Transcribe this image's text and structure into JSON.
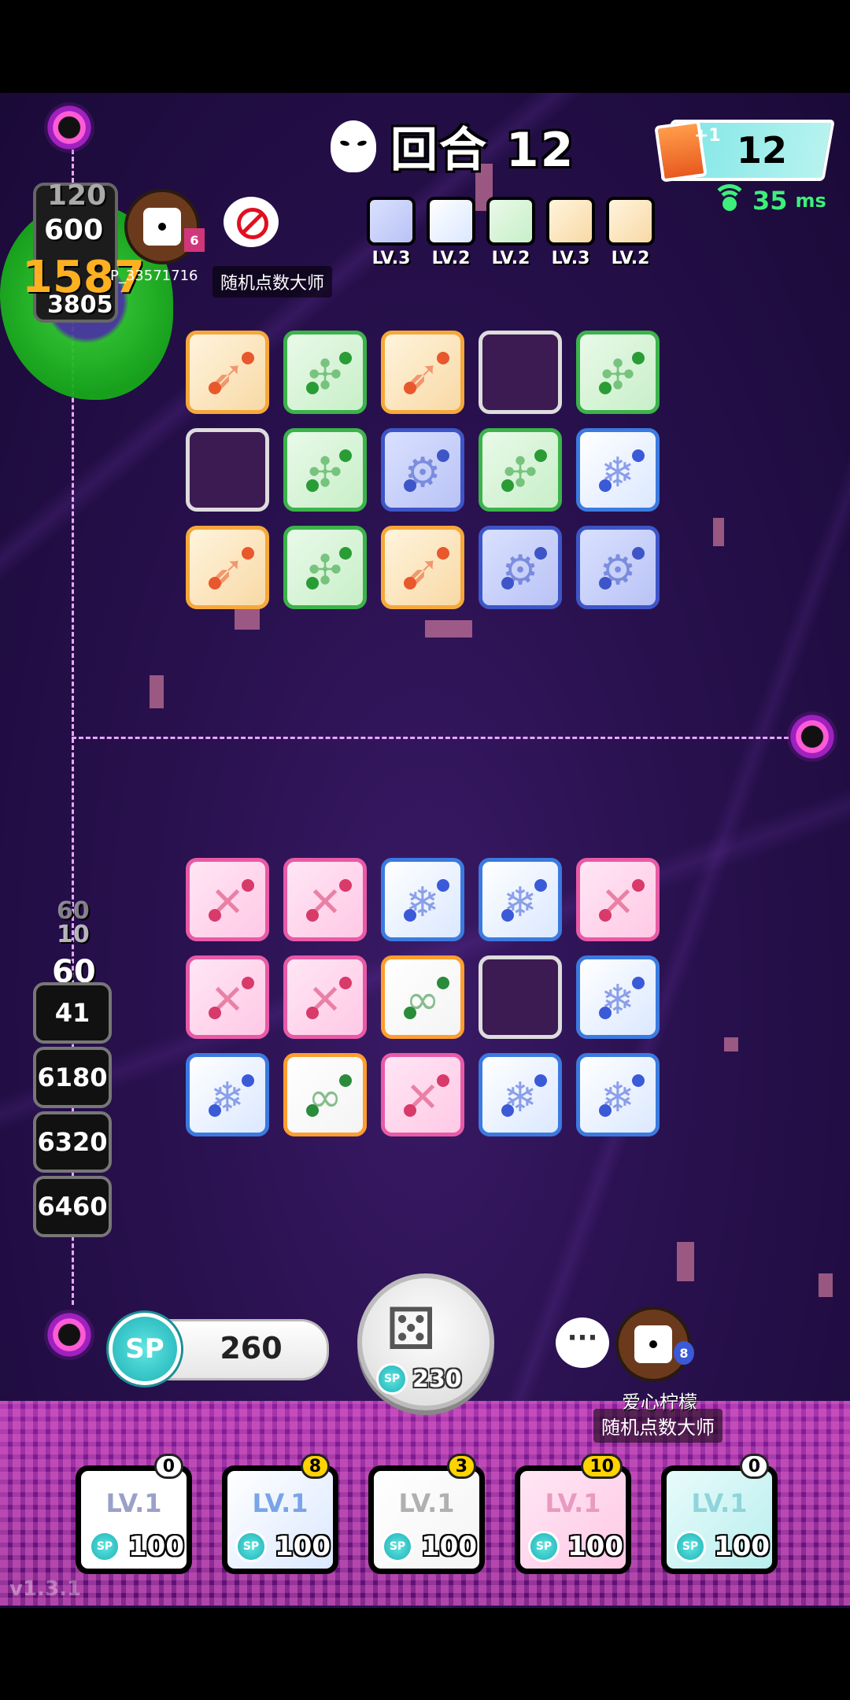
{
  "header": {
    "round_label": "回合 12",
    "coins": "12",
    "coins_plus": "+1",
    "ping_value": "35",
    "ping_unit": "ms"
  },
  "opponent": {
    "hp_values": [
      "120",
      "600"
    ],
    "damage_big": "1587",
    "damage_small": "3805",
    "name": "P_33571716",
    "title": "随机点数大师",
    "rank_badge": "6",
    "decks": [
      {
        "type": "gear",
        "level": "LV.3"
      },
      {
        "type": "ice",
        "level": "LV.2"
      },
      {
        "type": "wind",
        "level": "LV.2"
      },
      {
        "type": "arrow",
        "level": "LV.3"
      },
      {
        "type": "light",
        "level": "LV.2"
      }
    ],
    "board": [
      [
        "arrow",
        "wind",
        "arrow",
        "empty",
        "wind"
      ],
      [
        "empty",
        "wind",
        "gear",
        "wind",
        "ice"
      ],
      [
        "arrow",
        "wind",
        "arrow",
        "gear",
        "gear"
      ]
    ]
  },
  "player": {
    "name": "爱心柠檬",
    "title": "随机点数大师",
    "rank_badge": "8",
    "floating_numbers": [
      "60",
      "10",
      "60"
    ],
    "hp_values": [
      "41",
      "6180",
      "6320",
      "6460"
    ],
    "board": [
      [
        "pink",
        "pink",
        "ice",
        "ice",
        "pink"
      ],
      [
        "pink",
        "pink",
        "inf",
        "empty",
        "ice"
      ],
      [
        "ice",
        "inf",
        "pink",
        "ice",
        "ice"
      ]
    ],
    "sp": "260",
    "sp_label": "SP",
    "roll_cost": "230",
    "chat": "···"
  },
  "hand": [
    {
      "type": "rainbow",
      "level": "LV.1",
      "cost": "100",
      "count": "0"
    },
    {
      "type": "ice",
      "level": "LV.1",
      "cost": "100",
      "count": "8"
    },
    {
      "type": "inf",
      "level": "LV.1",
      "cost": "100",
      "count": "3"
    },
    {
      "type": "pink",
      "level": "LV.1",
      "cost": "100",
      "count": "10"
    },
    {
      "type": "teal",
      "level": "LV.1",
      "cost": "100",
      "count": "0"
    }
  ],
  "version": "v1.3.1",
  "colors": {
    "sp_teal": "#1fb0b8",
    "ping_green": "#3cf07a",
    "dashed_path": "#e8a6ff",
    "count_highlight": "#ffd400"
  },
  "icons": [
    "mask-icon",
    "wifi-icon",
    "no-entry-icon",
    "dice-icon",
    "portal-icon",
    "sp-coin-icon"
  ]
}
